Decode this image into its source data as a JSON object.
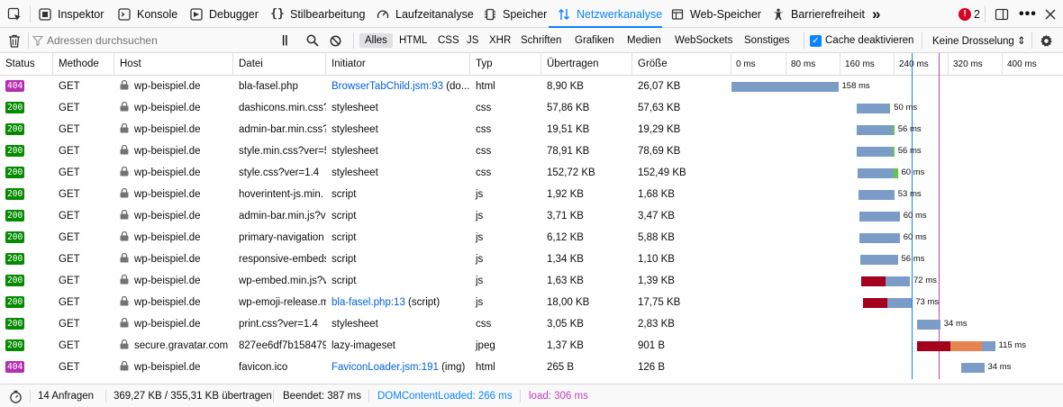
{
  "tabs": [
    {
      "label": "Inspektor",
      "icon": "inspector-icon"
    },
    {
      "label": "Konsole",
      "icon": "console-icon"
    },
    {
      "label": "Debugger",
      "icon": "debugger-icon"
    },
    {
      "label": "Stilbearbeitung",
      "icon": "style-editor-icon"
    },
    {
      "label": "Laufzeitanalyse",
      "icon": "performance-icon"
    },
    {
      "label": "Speicher",
      "icon": "memory-icon"
    },
    {
      "label": "Netzwerkanalyse",
      "icon": "network-icon",
      "active": true
    },
    {
      "label": "Web-Speicher",
      "icon": "storage-icon"
    },
    {
      "label": "Barrierefreiheit",
      "icon": "accessibility-icon"
    }
  ],
  "tab_overflow": "»",
  "error_count": "2",
  "toolbar": {
    "search_placeholder": "Adressen durchsuchen",
    "pause_label": "||",
    "filters": [
      "Alles",
      "HTML",
      "CSS",
      "JS",
      "XHR",
      "Schriften",
      "Grafiken",
      "Medien",
      "WebSockets",
      "Sonstiges"
    ],
    "selected_filter": "Alles",
    "cache_label": "Cache deaktivieren",
    "throttle_label": "Keine Drosselung ⇕"
  },
  "columns": [
    "Status",
    "Methode",
    "Host",
    "Datei",
    "Initiator",
    "Typ",
    "Übertragen",
    "Größe"
  ],
  "waterfall_ticks": [
    "0 ms",
    "80 ms",
    "160 ms",
    "240 ms",
    "320 ms",
    "400 ms"
  ],
  "colors": {
    "accent": "#0a84ff",
    "ok_badge": "#058b00",
    "err_badge": "#b42fb0",
    "bar_receive": "#7a9cc6",
    "bar_wait": "#a4001d",
    "bar_blocked": "#e58451",
    "bar_green": "#5fc749",
    "dcl_line": "#0a84ff",
    "load_line": "#c13ec3"
  },
  "requests": [
    {
      "status": "404",
      "method": "GET",
      "host": "wp-beispiel.de",
      "file": "bla-fasel.php",
      "initiator": "BrowserTabChild.jsm:93",
      "initiator_suffix": " (do...",
      "type": "html",
      "transferred": "8,90 KB",
      "size": "26,07 KB",
      "time": "158 ms",
      "start": 0,
      "wait": 0,
      "blocked": 0,
      "recv": 158,
      "green": 0
    },
    {
      "status": "200",
      "method": "GET",
      "host": "wp-beispiel.de",
      "file": "dashicons.min.css?",
      "initiator": "stylesheet",
      "initiator_suffix": "",
      "type": "css",
      "transferred": "57,86 KB",
      "size": "57,63 KB",
      "time": "50 ms",
      "start": 185,
      "wait": 0,
      "blocked": 0,
      "recv": 48,
      "green": 2
    },
    {
      "status": "200",
      "method": "GET",
      "host": "wp-beispiel.de",
      "file": "admin-bar.min.css?",
      "initiator": "stylesheet",
      "initiator_suffix": "",
      "type": "css",
      "transferred": "19,51 KB",
      "size": "19,29 KB",
      "time": "56 ms",
      "start": 185,
      "wait": 0,
      "blocked": 0,
      "recv": 54,
      "green": 2
    },
    {
      "status": "200",
      "method": "GET",
      "host": "wp-beispiel.de",
      "file": "style.min.css?ver=5",
      "initiator": "stylesheet",
      "initiator_suffix": "",
      "type": "css",
      "transferred": "78,91 KB",
      "size": "78,69 KB",
      "time": "56 ms",
      "start": 185,
      "wait": 0,
      "blocked": 0,
      "recv": 54,
      "green": 2
    },
    {
      "status": "200",
      "method": "GET",
      "host": "wp-beispiel.de",
      "file": "style.css?ver=1.4",
      "initiator": "stylesheet",
      "initiator_suffix": "",
      "type": "css",
      "transferred": "152,72 KB",
      "size": "152,49 KB",
      "time": "60 ms",
      "start": 186,
      "wait": 0,
      "blocked": 0,
      "recv": 54,
      "green": 6
    },
    {
      "status": "200",
      "method": "GET",
      "host": "wp-beispiel.de",
      "file": "hoverintent-js.min.",
      "initiator": "script",
      "initiator_suffix": "",
      "type": "js",
      "transferred": "1,92 KB",
      "size": "1,68 KB",
      "time": "53 ms",
      "start": 188,
      "wait": 0,
      "blocked": 0,
      "recv": 53,
      "green": 0
    },
    {
      "status": "200",
      "method": "GET",
      "host": "wp-beispiel.de",
      "file": "admin-bar.min.js?v",
      "initiator": "script",
      "initiator_suffix": "",
      "type": "js",
      "transferred": "3,71 KB",
      "size": "3,47 KB",
      "time": "60 ms",
      "start": 189,
      "wait": 0,
      "blocked": 0,
      "recv": 60,
      "green": 0
    },
    {
      "status": "200",
      "method": "GET",
      "host": "wp-beispiel.de",
      "file": "primary-navigation",
      "initiator": "script",
      "initiator_suffix": "",
      "type": "js",
      "transferred": "6,12 KB",
      "size": "5,88 KB",
      "time": "60 ms",
      "start": 189,
      "wait": 0,
      "blocked": 0,
      "recv": 60,
      "green": 0
    },
    {
      "status": "200",
      "method": "GET",
      "host": "wp-beispiel.de",
      "file": "responsive-embeds",
      "initiator": "script",
      "initiator_suffix": "",
      "type": "js",
      "transferred": "1,34 KB",
      "size": "1,10 KB",
      "time": "56 ms",
      "start": 190,
      "wait": 0,
      "blocked": 0,
      "recv": 56,
      "green": 0
    },
    {
      "status": "200",
      "method": "GET",
      "host": "wp-beispiel.de",
      "file": "wp-embed.min.js?v",
      "initiator": "script",
      "initiator_suffix": "",
      "type": "js",
      "transferred": "1,63 KB",
      "size": "1,39 KB",
      "time": "72 ms",
      "start": 192,
      "wait": 36,
      "blocked": 0,
      "recv": 36,
      "green": 0
    },
    {
      "status": "200",
      "method": "GET",
      "host": "wp-beispiel.de",
      "file": "wp-emoji-release.m",
      "initiator": "bla-fasel.php:13",
      "initiator_suffix": " (script)",
      "type": "js",
      "transferred": "18,00 KB",
      "size": "17,75 KB",
      "time": "73 ms",
      "start": 194,
      "wait": 37,
      "blocked": 0,
      "recv": 36,
      "green": 0
    },
    {
      "status": "200",
      "method": "GET",
      "host": "wp-beispiel.de",
      "file": "print.css?ver=1.4",
      "initiator": "stylesheet",
      "initiator_suffix": "",
      "type": "css",
      "transferred": "3,05 KB",
      "size": "2,83 KB",
      "time": "34 ms",
      "start": 275,
      "wait": 0,
      "blocked": 0,
      "recv": 34,
      "green": 0
    },
    {
      "status": "200",
      "method": "GET",
      "host": "secure.gravatar.com",
      "file": "827ee6df7b158479",
      "initiator": "lazy-imageset",
      "initiator_suffix": "",
      "type": "jpeg",
      "transferred": "1,37 KB",
      "size": "901 B",
      "time": "115 ms",
      "start": 275,
      "wait": 49,
      "blocked": 46,
      "recv": 20,
      "green": 0
    },
    {
      "status": "404",
      "method": "GET",
      "host": "wp-beispiel.de",
      "file": "favicon.ico",
      "initiator": "FaviconLoader.jsm:191",
      "initiator_suffix": " (img)",
      "type": "html",
      "transferred": "265 B",
      "size": "126 B",
      "time": "34 ms",
      "start": 340,
      "wait": 0,
      "blocked": 0,
      "recv": 34,
      "green": 0
    }
  ],
  "markers": {
    "dcl_ms": 266,
    "load_ms": 306
  },
  "statusbar": {
    "requests": "14 Anfragen",
    "transferred": "369,27 KB / 355,31 KB übertragen",
    "finished": "Beendet: 387 ms",
    "dcl": "DOMContentLoaded: 266 ms",
    "load": "load: 306 ms"
  }
}
